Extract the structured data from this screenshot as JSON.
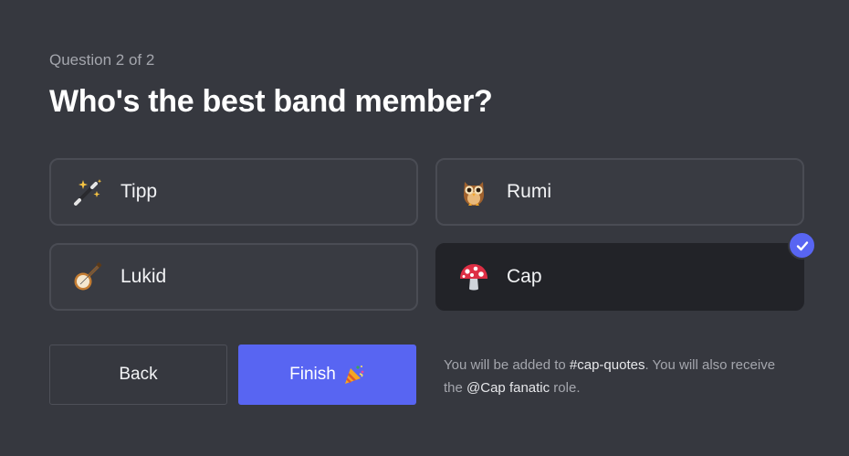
{
  "progress_label": "Question 2 of 2",
  "question_title": "Who's the best band member?",
  "options": [
    {
      "label": "Tipp",
      "icon": "magic-wand-icon",
      "selected": false
    },
    {
      "label": "Rumi",
      "icon": "owl-icon",
      "selected": false
    },
    {
      "label": "Lukid",
      "icon": "banjo-icon",
      "selected": false
    },
    {
      "label": "Cap",
      "icon": "mushroom-icon",
      "selected": true
    }
  ],
  "buttons": {
    "back_label": "Back",
    "finish_label": "Finish",
    "finish_icon": "party-popper-icon"
  },
  "info": {
    "part1": "You will be added to ",
    "channel": "#cap-quotes",
    "part2": ". You will also receive the ",
    "role": "@Cap fanatic",
    "part3": " role."
  },
  "colors": {
    "background": "#36383f",
    "accent": "#5865f2",
    "selected_option_bg": "#222328"
  }
}
